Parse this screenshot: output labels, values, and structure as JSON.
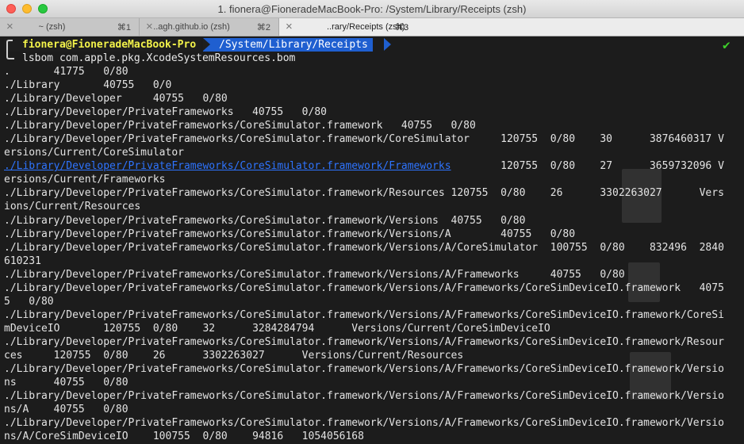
{
  "window": {
    "title": "1. fionera@FioneradeMacBook-Pro: /System/Library/Receipts (zsh)"
  },
  "tabs": [
    {
      "label": "~ (zsh)",
      "shortcut": "⌘1",
      "active": false
    },
    {
      "label": "..agh.github.io (zsh)",
      "shortcut": "⌘2",
      "active": false
    },
    {
      "label": "..rary/Receipts (zsh)",
      "shortcut": "⌘3",
      "active": true
    }
  ],
  "prompt": {
    "user_host": "fionera@FioneradeMacBook-Pro",
    "path": "/System/Library/Receipts",
    "status": "✔"
  },
  "command": "lsbom com.apple.pkg.XcodeSystemResources.bom",
  "output_lines": [
    ".       41775   0/80",
    "./Library       40755   0/0",
    "./Library/Developer     40755   0/80",
    "./Library/Developer/PrivateFrameworks   40755   0/80",
    "./Library/Developer/PrivateFrameworks/CoreSimulator.framework   40755   0/80",
    "./Library/Developer/PrivateFrameworks/CoreSimulator.framework/CoreSimulator     120755  0/80    30      3876460317 V",
    "ersions/Current/CoreSimulator",
    "./Library/Developer/PrivateFrameworks/CoreSimulator.framework/Frameworks        120755  0/80    27      3659732096 V",
    "ersions/Current/Frameworks",
    "./Library/Developer/PrivateFrameworks/CoreSimulator.framework/Resources 120755  0/80    26      3302263027      Vers",
    "ions/Current/Resources",
    "./Library/Developer/PrivateFrameworks/CoreSimulator.framework/Versions  40755   0/80",
    "./Library/Developer/PrivateFrameworks/CoreSimulator.framework/Versions/A        40755   0/80",
    "./Library/Developer/PrivateFrameworks/CoreSimulator.framework/Versions/A/CoreSimulator  100755  0/80    832496  2840",
    "610231",
    "./Library/Developer/PrivateFrameworks/CoreSimulator.framework/Versions/A/Frameworks     40755   0/80",
    "./Library/Developer/PrivateFrameworks/CoreSimulator.framework/Versions/A/Frameworks/CoreSimDeviceIO.framework   4075",
    "5   0/80",
    "./Library/Developer/PrivateFrameworks/CoreSimulator.framework/Versions/A/Frameworks/CoreSimDeviceIO.framework/CoreSi",
    "mDeviceIO       120755  0/80    32      3284284794      Versions/Current/CoreSimDeviceIO",
    "./Library/Developer/PrivateFrameworks/CoreSimulator.framework/Versions/A/Frameworks/CoreSimDeviceIO.framework/Resour",
    "ces     120755  0/80    26      3302263027      Versions/Current/Resources",
    "./Library/Developer/PrivateFrameworks/CoreSimulator.framework/Versions/A/Frameworks/CoreSimDeviceIO.framework/Versio",
    "ns      40755   0/80",
    "./Library/Developer/PrivateFrameworks/CoreSimulator.framework/Versions/A/Frameworks/CoreSimDeviceIO.framework/Versio",
    "ns/A    40755   0/80",
    "./Library/Developer/PrivateFrameworks/CoreSimulator.framework/Versions/A/Frameworks/CoreSimDeviceIO.framework/Versio",
    "ns/A/CoreSimDeviceIO    100755  0/80    94816   1054056168"
  ],
  "highlight_line": {
    "index": 7,
    "link_text": "./Library/Developer/PrivateFrameworks/CoreSimulator.framework/Frameworks",
    "color": "#2e74ff"
  },
  "colors": {
    "prompt_user": "#f2f24a",
    "prompt_path_bg": "#1f5fd0",
    "status_ok": "#3ecf2a",
    "terminal_bg": "#1c1c1c"
  }
}
